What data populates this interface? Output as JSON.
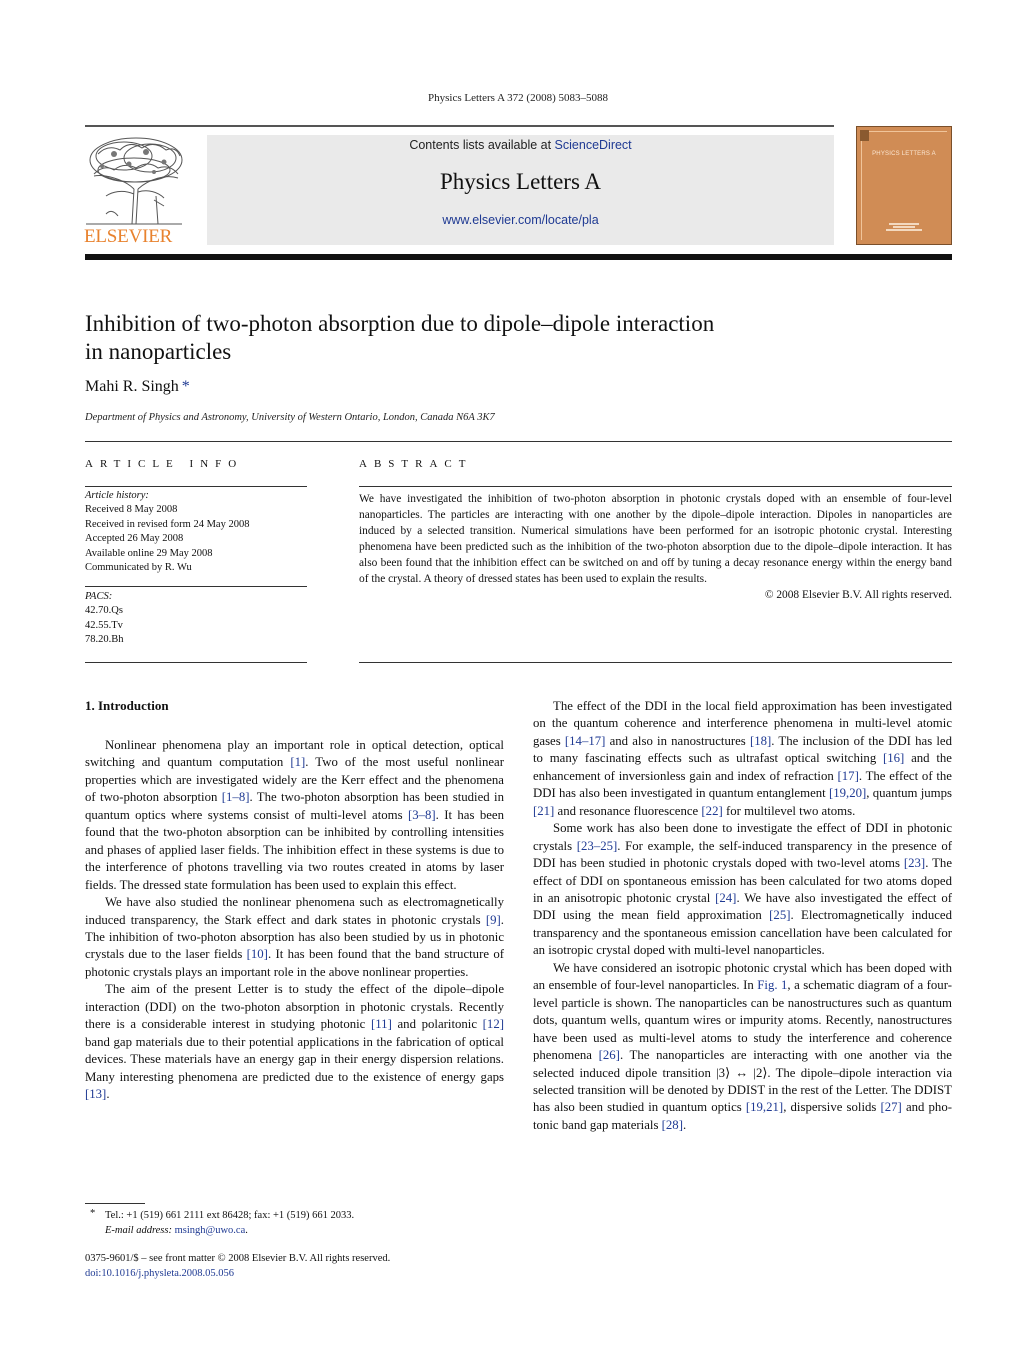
{
  "header": {
    "citation": "Physics Letters A 372 (2008) 5083–5088",
    "contents_prefix": "Contents lists available at ",
    "contents_link": "ScienceDirect",
    "journal_title": "Physics Letters A",
    "journal_url": "www.elsevier.com/locate/pla",
    "publisher_logo_text": "ELSEVIER",
    "cover_title": "PHYSICS LETTERS A",
    "brand_color": "#e8822e",
    "link_color": "#1f3a93",
    "cover_color": "#d08c55"
  },
  "article": {
    "title_line1": "Inhibition of two-photon absorption due to dipole–dipole interaction",
    "title_line2": "in nanoparticles",
    "author": "Mahi R. Singh",
    "author_mark": "*",
    "affiliation": "Department of Physics and Astronomy, University of Western Ontario, London, Canada N6A 3K7"
  },
  "article_info": {
    "heading": "ARTICLE INFO",
    "history_label": "Article history:",
    "history": [
      "Received 8 May 2008",
      "Received in revised form 24 May 2008",
      "Accepted 26 May 2008",
      "Available online 29 May 2008",
      "Communicated by R. Wu"
    ],
    "pacs_label": "PACS:",
    "pacs": [
      "42.70.Qs",
      "42.55.Tv",
      "78.20.Bh"
    ]
  },
  "abstract": {
    "heading": "ABSTRACT",
    "text": "We have investigated the inhibition of two-photon absorption in photonic crystals doped with an ensemble of four-level nanoparticles. The particles are interacting with one another by the dipole–dipole interaction. Dipoles in nanoparticles are induced by a selected transition. Numerical simulations have been performed for an isotropic photonic crystal. Interesting phenomena have been predicted such as the inhibition of the two-photon absorption due to the dipole–dipole interaction. It has also been found that the inhibition effect can be switched on and off by tuning a decay resonance energy within the energy band of the crystal. A theory of dressed states has been used to explain the results.",
    "copyright": "© 2008 Elsevier B.V. All rights reserved."
  },
  "body": {
    "section_heading": "1. Introduction",
    "left_paragraphs": [
      [
        {
          "t": "Nonlinear phenomena play an important role in optical detec­tion, optical switching and quantum computation "
        },
        {
          "r": "[1]"
        },
        {
          "t": ". Two of the most useful nonlinear properties which are investigated widely are the Kerr effect and the phenomena of two-photon absorption "
        },
        {
          "r": "[1–8]"
        },
        {
          "t": ". The two-photon absorption has been studied in quantum optics where systems consist of multi-level atoms "
        },
        {
          "r": "[3–8]"
        },
        {
          "t": ". It has been found that the two-photon absorption can be inhibited by controlling intensities and phases of applied laser fields. The in­hibition effect in these systems is due to the interference of pho­tons travelling via two routes created in atoms by laser fields. The dressed state formulation has been used to explain this effect."
        }
      ],
      [
        {
          "t": "We have also studied the nonlinear phenomena such as electro­magnetically induced transparency, the Stark effect and dark states in photonic crystals "
        },
        {
          "r": "[9]"
        },
        {
          "t": ". The inhibition of two-photon absorption has also been studied by us in photonic crystals due to the laser fields "
        },
        {
          "r": "[10]"
        },
        {
          "t": ". It has been found that the band structure of photonic crystals plays an important role in the above nonlinear properties."
        }
      ],
      [
        {
          "t": "The aim of the present Letter is to study the effect of the dipole–dipole interaction (DDI) on the two-photon absorption in photonic crystals. Recently there is a considerable interest in study­ing photonic "
        },
        {
          "r": "[11]"
        },
        {
          "t": " and polaritonic "
        },
        {
          "r": "[12]"
        },
        {
          "t": " band gap materials due to their potential applications in the fabrication of optical devices. These materials have an energy gap in their energy dispersion relations. Many interesting phenomena are predicted due to the existence of energy gaps "
        },
        {
          "r": "[13]"
        },
        {
          "t": "."
        }
      ]
    ],
    "right_paragraphs": [
      [
        {
          "t": "The effect of the DDI in the local field approximation has been investigated on the quantum coherence and interference phenom­ena in multi-level atomic gases "
        },
        {
          "r": "[14–17]"
        },
        {
          "t": " and also in nanostructures "
        },
        {
          "r": "[18]"
        },
        {
          "t": ". The inclusion of the DDI has led to many fascinating effects such as ultrafast optical switching "
        },
        {
          "r": "[16]"
        },
        {
          "t": " and the enhancement of inversionless gain and index of refraction "
        },
        {
          "r": "[17]"
        },
        {
          "t": ". The effect of the DDI has also been investigated in quantum entanglement "
        },
        {
          "r": "[19,20]"
        },
        {
          "t": ", quantum jumps "
        },
        {
          "r": "[21]"
        },
        {
          "t": " and resonance fluorescence "
        },
        {
          "r": "[22]"
        },
        {
          "t": " for multi­level two atoms."
        }
      ],
      [
        {
          "t": "Some work has also been done to investigate the effect of DDI in photonic crystals "
        },
        {
          "r": "[23–25]"
        },
        {
          "t": ". For example, the self-induced transparency in the presence of DDI has been studied in photonic crystals doped with two-level atoms "
        },
        {
          "r": "[23]"
        },
        {
          "t": ". The effect of DDI on spontaneous emission has been calculated for two atoms doped in an anisotropic photonic crystal "
        },
        {
          "r": "[24]"
        },
        {
          "t": ". We have also investigated the effect of DDI using the mean field approximation "
        },
        {
          "r": "[25]"
        },
        {
          "t": ". Electro­magnetically induced transparency and the spontaneous emission cancellation have been calculated for an isotropic crystal doped with multi-level nanoparticles."
        }
      ],
      [
        {
          "t": "We have considered an isotropic photonic crystal which has been doped with an ensemble of four-level nanoparticles. In "
        },
        {
          "r": "Fig. 1"
        },
        {
          "t": ", a schematic diagram of a four-level particle is shown. The nanopar­ticles can be nanostructures such as quantum dots, quantum wells, quantum wires or impurity atoms. Recently, nanostructures have been used as multi-level atoms to study the interference and co­herence phenomena "
        },
        {
          "r": "[26]"
        },
        {
          "t": ". The nanoparticles are interacting with one another via the selected induced dipole transition |3⟩ ↔ |2⟩. The dipole–dipole interaction via selected transition will be de­noted by DDIST in the rest of the Letter. The DDIST has also been studied in quantum optics "
        },
        {
          "r": "[19,21]"
        },
        {
          "t": ", dispersive solids "
        },
        {
          "r": "[27]"
        },
        {
          "t": " and pho­tonic band gap materials "
        },
        {
          "r": "[28]"
        },
        {
          "t": "."
        }
      ]
    ]
  },
  "footnote": {
    "mark": "*",
    "contact": "Tel.: +1 (519) 661 2111 ext 86428; fax: +1 (519) 661 2033.",
    "email_label": "E-mail address:",
    "email": "msingh@uwo.ca",
    "email_suffix": "."
  },
  "bottom": {
    "front_matter": "0375-9601/$ – see front matter  © 2008 Elsevier B.V. All rights reserved.",
    "doi": "doi:10.1016/j.physleta.2008.05.056"
  }
}
